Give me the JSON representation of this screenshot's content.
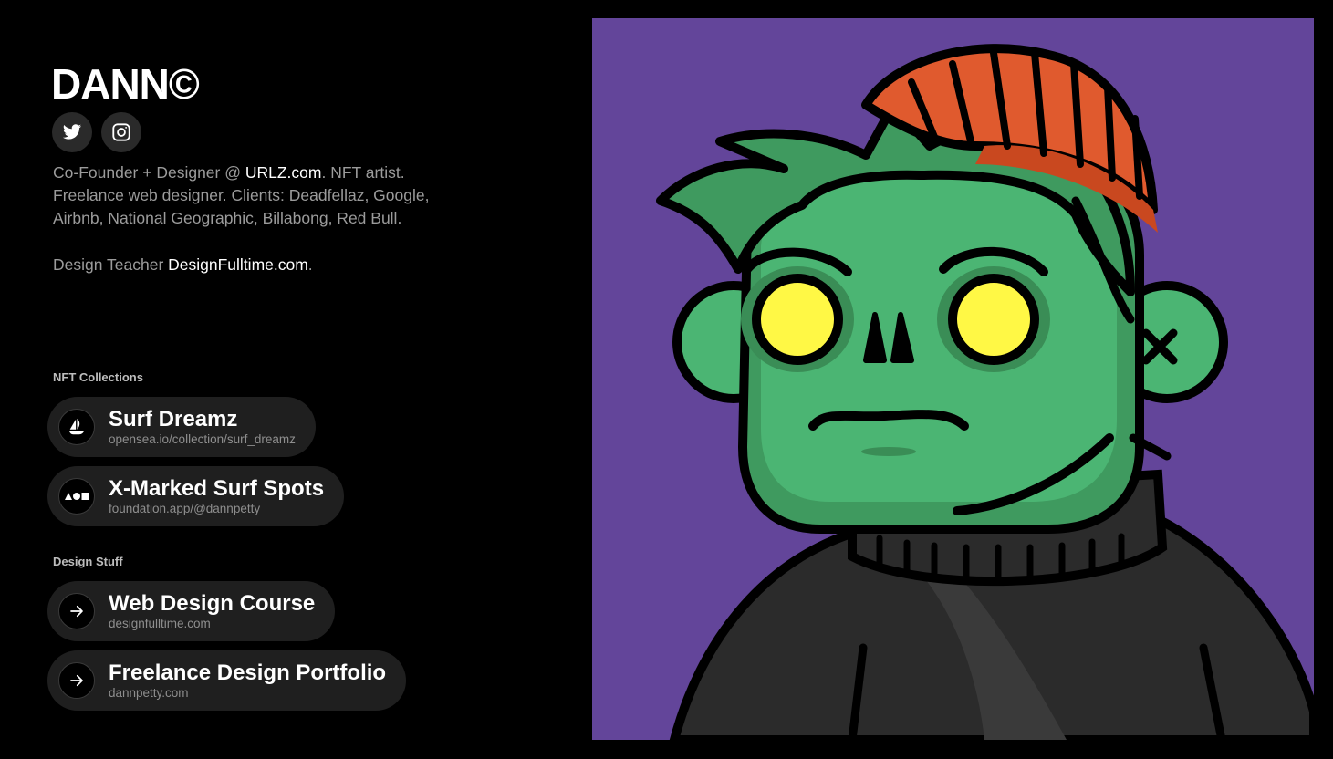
{
  "profile": {
    "name": "DANN©",
    "bio_line1_prefix": "Co-Founder + Designer @ ",
    "bio_link1": "URLZ.com",
    "bio_line1_suffix": ". NFT artist.",
    "bio_line2": "Freelance web designer. Clients: Deadfellaz, Google,",
    "bio_line3": "Airbnb, National Geographic, Billabong, Red Bull.",
    "teacher_prefix": "Design Teacher ",
    "teacher_link": "DesignFulltime.com",
    "teacher_suffix": "."
  },
  "socials": [
    {
      "icon": "twitter-icon"
    },
    {
      "icon": "instagram-icon"
    }
  ],
  "sections": {
    "nft_label": "NFT Collections",
    "design_label": "Design Stuff"
  },
  "nft_collections": [
    {
      "title": "Surf Dreamz",
      "url": "opensea.io/collection/surf_dreamz",
      "icon": "opensea-boat-icon"
    },
    {
      "title": "X-Marked Surf Spots",
      "url": "foundation.app/@dannpetty",
      "icon": "foundation-shapes-icon"
    }
  ],
  "design_links": [
    {
      "title": "Web Design Course",
      "url": "designfulltime.com",
      "icon": "arrow-right-icon"
    },
    {
      "title": "Freelance Design Portfolio",
      "url": "dannpetty.com",
      "icon": "arrow-right-icon"
    }
  ],
  "colors": {
    "background": "#000000",
    "pill": "#1f1f1f",
    "art_background": "#63459a",
    "skin": "#4bb573",
    "beanie": "#e05a2e",
    "eyes": "#fff845"
  }
}
